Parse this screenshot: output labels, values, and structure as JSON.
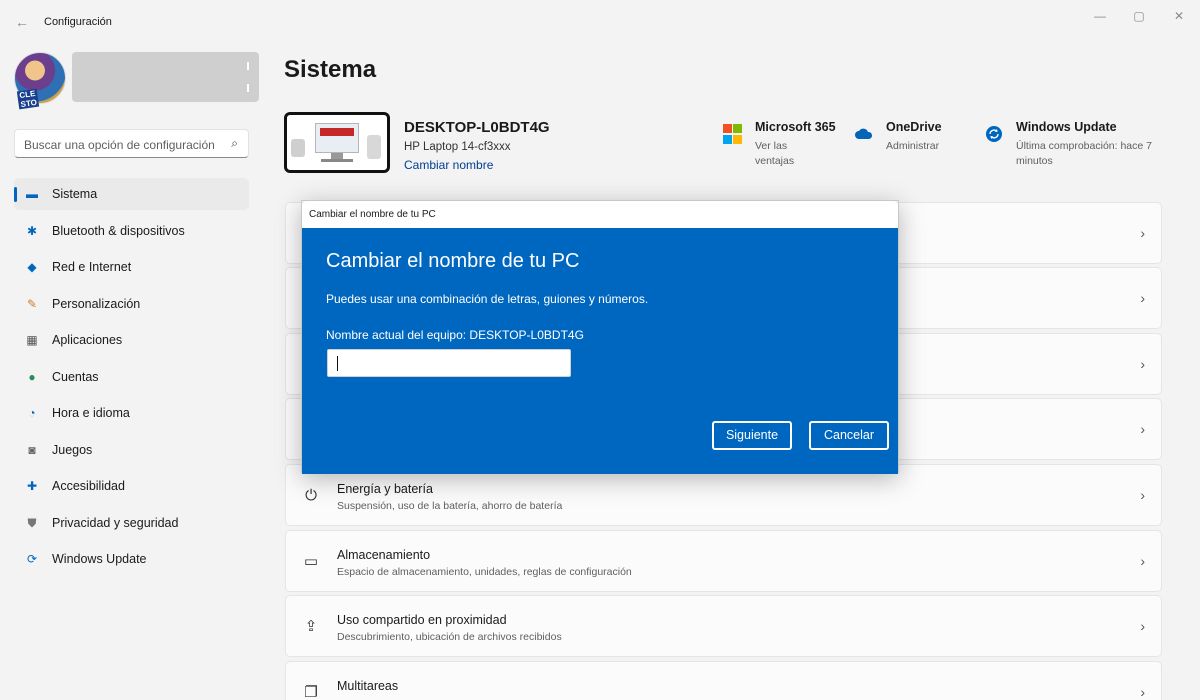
{
  "app": {
    "title": "Configuración"
  },
  "window_controls": {
    "minimize": "—",
    "maximize": "▢",
    "close": "✕"
  },
  "profile": {
    "avatar_text": "CLE STO"
  },
  "search": {
    "placeholder": "Buscar una opción de configuración"
  },
  "sidebar": {
    "items": [
      {
        "label": "Sistema",
        "icon": "monitor-icon",
        "glyph": "▬",
        "color": "#0067c0",
        "active": true
      },
      {
        "label": "Bluetooth & dispositivos",
        "icon": "bluetooth-icon",
        "glyph": "✱",
        "color": "#0067c0",
        "active": false
      },
      {
        "label": "Red e Internet",
        "icon": "wifi-icon",
        "glyph": "◆",
        "color": "#0067c0",
        "active": false
      },
      {
        "label": "Personalización",
        "icon": "brush-icon",
        "glyph": "✎",
        "color": "#d07a2d",
        "active": false
      },
      {
        "label": "Aplicaciones",
        "icon": "apps-icon",
        "glyph": "▦",
        "color": "#555555",
        "active": false
      },
      {
        "label": "Cuentas",
        "icon": "person-icon",
        "glyph": "●",
        "color": "#2e8b57",
        "active": false
      },
      {
        "label": "Hora e idioma",
        "icon": "clock-globe-icon",
        "glyph": "◔",
        "color": "#0067c0",
        "active": false
      },
      {
        "label": "Juegos",
        "icon": "gamepad-icon",
        "glyph": "◙",
        "color": "#666666",
        "active": false
      },
      {
        "label": "Accesibilidad",
        "icon": "accessibility-icon",
        "glyph": "✚",
        "color": "#0067c0",
        "active": false
      },
      {
        "label": "Privacidad y seguridad",
        "icon": "shield-icon",
        "glyph": "⛊",
        "color": "#777777",
        "active": false
      },
      {
        "label": "Windows Update",
        "icon": "update-icon",
        "glyph": "⟳",
        "color": "#0067c0",
        "active": false
      }
    ]
  },
  "main": {
    "title": "Sistema",
    "device": {
      "name": "DESKTOP-L0BDT4G",
      "model": "HP Laptop 14-cf3xxx",
      "rename_link": "Cambiar nombre"
    },
    "quick_links": [
      {
        "title": "Microsoft 365",
        "subtitle": "Ver las ventajas",
        "icon": "microsoft-logo-icon"
      },
      {
        "title": "OneDrive",
        "subtitle": "Administrar",
        "icon": "onedrive-cloud-icon"
      },
      {
        "title": "Windows Update",
        "subtitle": "Última comprobación: hace 7 minutos",
        "icon": "windows-update-icon"
      }
    ],
    "cards": [
      {
        "title": "",
        "subtitle": ""
      },
      {
        "title": "",
        "subtitle": ""
      },
      {
        "title": "",
        "subtitle": ""
      },
      {
        "title": "",
        "subtitle": ""
      },
      {
        "title": "Energía y batería",
        "subtitle": "Suspensión, uso de la batería, ahorro de batería",
        "icon": "power-icon",
        "glyph": "⏻"
      },
      {
        "title": "Almacenamiento",
        "subtitle": "Espacio de almacenamiento, unidades, reglas de configuración",
        "icon": "storage-icon",
        "glyph": "▭"
      },
      {
        "title": "Uso compartido en proximidad",
        "subtitle": "Descubrimiento, ubicación de archivos recibidos",
        "icon": "share-icon",
        "glyph": "⇪"
      },
      {
        "title": "Multitareas",
        "subtitle": "",
        "icon": "multitask-icon",
        "glyph": "❐"
      }
    ],
    "chevron": "›"
  },
  "dialog": {
    "window_title": "Cambiar el nombre de tu PC",
    "heading": "Cambiar el nombre de tu PC",
    "description": "Puedes usar una combinación de letras, guiones y números.",
    "current_name": "Nombre actual del equipo: DESKTOP-L0BDT4G",
    "input_value": "",
    "next_button": "Siguiente",
    "cancel_button": "Cancelar"
  },
  "colors": {
    "accent": "#0067c0",
    "dialog_bg": "#0067c0",
    "ms_red": "#f25022",
    "ms_green": "#7fba00",
    "ms_blue": "#00a4ef",
    "ms_yellow": "#ffb900"
  }
}
